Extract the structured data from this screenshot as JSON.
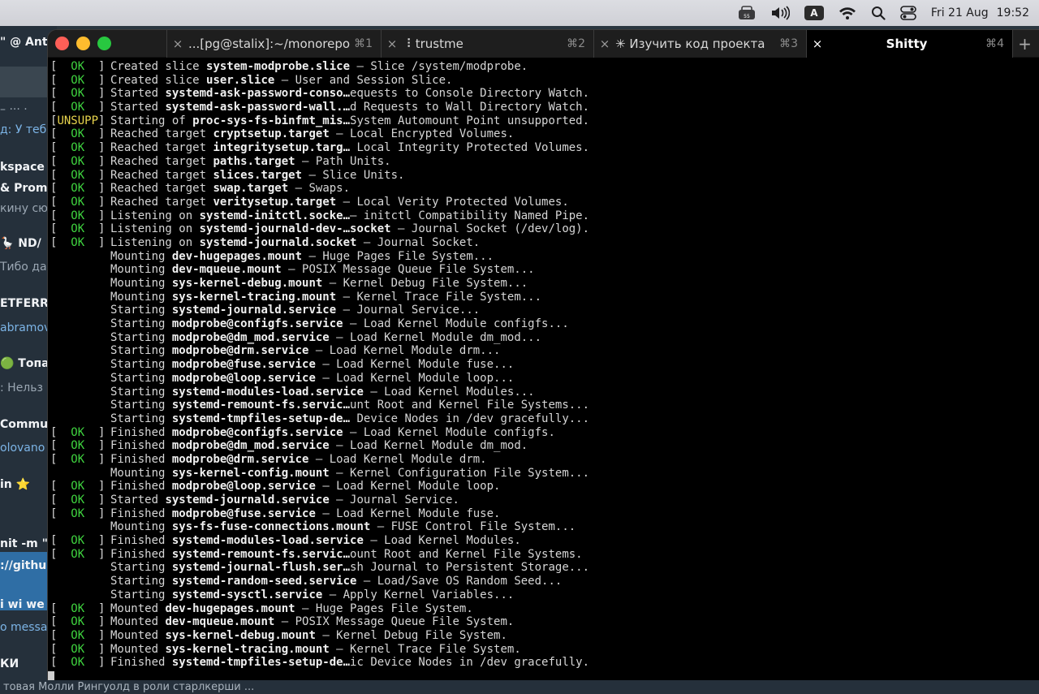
{
  "menubar": {
    "icons": [
      "keyboard-layout-icon",
      "volume-icon",
      "input-source-icon",
      "wifi-icon",
      "search-icon",
      "control-center-icon"
    ],
    "input_source": "A",
    "date": "Fri 21 Aug",
    "time": "19:52"
  },
  "background_app": {
    "rows": [
      {
        "text": "\" @ Ant",
        "style": "strong"
      },
      {
        "text": "– ··· ·",
        "style": "muted"
      },
      {
        "text": "д: У теб",
        "style": "blue"
      },
      {
        "text": "kspace |",
        "style": "strong"
      },
      {
        "text": "& Prom",
        "style": "strong"
      },
      {
        "text": "кину сю",
        "style": "muted"
      },
      {
        "text": "🪿 ND/",
        "style": "strong"
      },
      {
        "text": "Тибо да",
        "style": "muted"
      },
      {
        "text": "ETFERRO",
        "style": "strong"
      },
      {
        "text": "abramov",
        "style": "blue"
      },
      {
        "text": "🟢 Топаз",
        "style": "strong"
      },
      {
        "text": ": Нельз",
        "style": "muted"
      },
      {
        "text": "Commu",
        "style": "strong"
      },
      {
        "text": "olovano",
        "style": "blue"
      },
      {
        "text": "in ⭐",
        "style": "strong"
      },
      {
        "text": "nit -m \"b",
        "style": "strong"
      },
      {
        "text": "://github",
        "style": "strong"
      },
      {
        "text": "i wi we",
        "style": "strong"
      },
      {
        "text": "o messag",
        "style": "blue"
      },
      {
        "text": "КИ",
        "style": "strong"
      }
    ],
    "bottom_text": "товая Молли Рингуолд в роли старлкерши ..."
  },
  "terminal": {
    "tabs": [
      {
        "title": "...[pg@stalix]:~/monorepo",
        "key": "⌘1",
        "close": "×",
        "active": false
      },
      {
        "title": "⠸ trustme",
        "key": "⌘2",
        "close": "×",
        "active": false
      },
      {
        "title": "✳ Изучить код проекта",
        "key": "⌘3",
        "close": "×",
        "active": false
      },
      {
        "title": "Shitty",
        "key": "⌘4",
        "close": "×",
        "active": true
      }
    ],
    "new_tab": "+",
    "lines": [
      {
        "status": "OK",
        "verb": "Created slice",
        "unit": "system-modprobe.slice",
        "desc": " – Slice /system/modprobe."
      },
      {
        "status": "OK",
        "verb": "Created slice",
        "unit": "user.slice",
        "desc": " – User and Session Slice."
      },
      {
        "status": "OK",
        "verb": "Started",
        "unit": "systemd-ask-password-conso…",
        "desc": "equests to Console Directory Watch."
      },
      {
        "status": "OK",
        "verb": "Started",
        "unit": "systemd-ask-password-wall.…",
        "desc": "d Requests to Wall Directory Watch."
      },
      {
        "status": "UNSUPP",
        "verb": "Starting of",
        "unit": "proc-sys-fs-binfmt_mis…",
        "desc": "System Automount Point unsupported."
      },
      {
        "status": "OK",
        "verb": "Reached target",
        "unit": "cryptsetup.target",
        "desc": " – Local Encrypted Volumes."
      },
      {
        "status": "OK",
        "verb": "Reached target",
        "unit": "integritysetup.targ…",
        "desc": " Local Integrity Protected Volumes."
      },
      {
        "status": "OK",
        "verb": "Reached target",
        "unit": "paths.target",
        "desc": " – Path Units."
      },
      {
        "status": "OK",
        "verb": "Reached target",
        "unit": "slices.target",
        "desc": " – Slice Units."
      },
      {
        "status": "OK",
        "verb": "Reached target",
        "unit": "swap.target",
        "desc": " – Swaps."
      },
      {
        "status": "OK",
        "verb": "Reached target",
        "unit": "veritysetup.target",
        "desc": " – Local Verity Protected Volumes."
      },
      {
        "status": "OK",
        "verb": "Listening on",
        "unit": "systemd-initctl.socke…",
        "desc": "– initctl Compatibility Named Pipe."
      },
      {
        "status": "OK",
        "verb": "Listening on",
        "unit": "systemd-journald-dev-…socket",
        "desc": " – Journal Socket (/dev/log)."
      },
      {
        "status": "OK",
        "verb": "Listening on",
        "unit": "systemd-journald.socket",
        "desc": " – Journal Socket."
      },
      {
        "status": "",
        "verb": "Mounting",
        "unit": "dev-hugepages.mount",
        "desc": " – Huge Pages File System..."
      },
      {
        "status": "",
        "verb": "Mounting",
        "unit": "dev-mqueue.mount",
        "desc": " – POSIX Message Queue File System..."
      },
      {
        "status": "",
        "verb": "Mounting",
        "unit": "sys-kernel-debug.mount",
        "desc": " – Kernel Debug File System..."
      },
      {
        "status": "",
        "verb": "Mounting",
        "unit": "sys-kernel-tracing.mount",
        "desc": " – Kernel Trace File System..."
      },
      {
        "status": "",
        "verb": "Starting",
        "unit": "systemd-journald.service",
        "desc": " – Journal Service..."
      },
      {
        "status": "",
        "verb": "Starting",
        "unit": "modprobe@configfs.service",
        "desc": " – Load Kernel Module configfs..."
      },
      {
        "status": "",
        "verb": "Starting",
        "unit": "modprobe@dm_mod.service",
        "desc": " – Load Kernel Module dm_mod..."
      },
      {
        "status": "",
        "verb": "Starting",
        "unit": "modprobe@drm.service",
        "desc": " – Load Kernel Module drm..."
      },
      {
        "status": "",
        "verb": "Starting",
        "unit": "modprobe@fuse.service",
        "desc": " – Load Kernel Module fuse..."
      },
      {
        "status": "",
        "verb": "Starting",
        "unit": "modprobe@loop.service",
        "desc": " – Load Kernel Module loop..."
      },
      {
        "status": "",
        "verb": "Starting",
        "unit": "systemd-modules-load.service",
        "desc": " – Load Kernel Modules..."
      },
      {
        "status": "",
        "verb": "Starting",
        "unit": "systemd-remount-fs.servic…",
        "desc": "unt Root and Kernel File Systems..."
      },
      {
        "status": "",
        "verb": "Starting",
        "unit": "systemd-tmpfiles-setup-de…",
        "desc": " Device Nodes in /dev gracefully..."
      },
      {
        "status": "OK",
        "verb": "Finished",
        "unit": "modprobe@configfs.service",
        "desc": " – Load Kernel Module configfs."
      },
      {
        "status": "OK",
        "verb": "Finished",
        "unit": "modprobe@dm_mod.service",
        "desc": " – Load Kernel Module dm_mod."
      },
      {
        "status": "OK",
        "verb": "Finished",
        "unit": "modprobe@drm.service",
        "desc": " – Load Kernel Module drm."
      },
      {
        "status": "",
        "verb": "Mounting",
        "unit": "sys-kernel-config.mount",
        "desc": " – Kernel Configuration File System..."
      },
      {
        "status": "OK",
        "verb": "Finished",
        "unit": "modprobe@loop.service",
        "desc": " – Load Kernel Module loop."
      },
      {
        "status": "OK",
        "verb": "Started",
        "unit": "systemd-journald.service",
        "desc": " – Journal Service."
      },
      {
        "status": "OK",
        "verb": "Finished",
        "unit": "modprobe@fuse.service",
        "desc": " – Load Kernel Module fuse."
      },
      {
        "status": "",
        "verb": "Mounting",
        "unit": "sys-fs-fuse-connections.mount",
        "desc": " – FUSE Control File System..."
      },
      {
        "status": "OK",
        "verb": "Finished",
        "unit": "systemd-modules-load.service",
        "desc": " – Load Kernel Modules."
      },
      {
        "status": "OK",
        "verb": "Finished",
        "unit": "systemd-remount-fs.servic…",
        "desc": "ount Root and Kernel File Systems."
      },
      {
        "status": "",
        "verb": "Starting",
        "unit": "systemd-journal-flush.ser…",
        "desc": "sh Journal to Persistent Storage..."
      },
      {
        "status": "",
        "verb": "Starting",
        "unit": "systemd-random-seed.service",
        "desc": " – Load/Save OS Random Seed..."
      },
      {
        "status": "",
        "verb": "Starting",
        "unit": "systemd-sysctl.service",
        "desc": " – Apply Kernel Variables..."
      },
      {
        "status": "OK",
        "verb": "Mounted",
        "unit": "dev-hugepages.mount",
        "desc": " – Huge Pages File System."
      },
      {
        "status": "OK",
        "verb": "Mounted",
        "unit": "dev-mqueue.mount",
        "desc": " – POSIX Message Queue File System."
      },
      {
        "status": "OK",
        "verb": "Mounted",
        "unit": "sys-kernel-debug.mount",
        "desc": " – Kernel Debug File System."
      },
      {
        "status": "OK",
        "verb": "Mounted",
        "unit": "sys-kernel-tracing.mount",
        "desc": " – Kernel Trace File System."
      },
      {
        "status": "OK",
        "verb": "Finished",
        "unit": "systemd-tmpfiles-setup-de…",
        "desc": "ic Device Nodes in /dev gracefully."
      }
    ]
  },
  "colors": {
    "ok": "#3fd33f",
    "unsupp": "#e8d44d",
    "terminal_bg": "#000000",
    "close_red": "#fe5f57",
    "minimize_yellow": "#febc2e",
    "zoom_green": "#28c840"
  }
}
